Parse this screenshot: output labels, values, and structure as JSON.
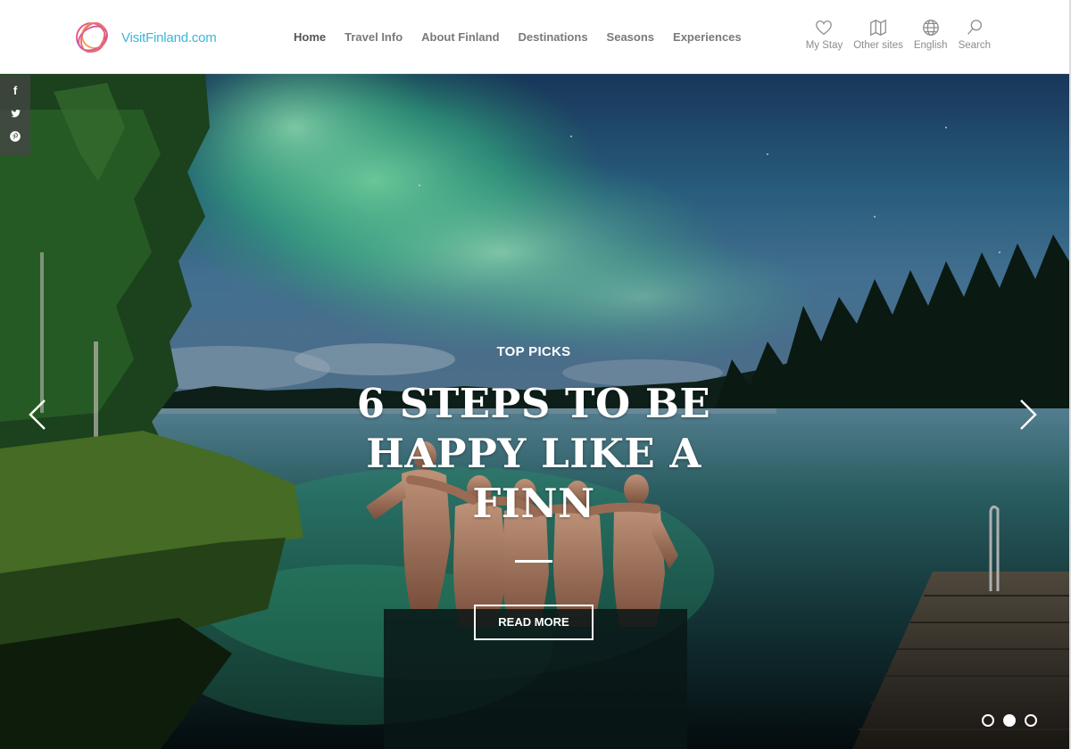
{
  "site": {
    "logo_text": "VisitFinland.com"
  },
  "nav": {
    "items": [
      {
        "label": "Home",
        "active": true
      },
      {
        "label": "Travel Info"
      },
      {
        "label": "About Finland"
      },
      {
        "label": "Destinations"
      },
      {
        "label": "Seasons"
      },
      {
        "label": "Experiences"
      }
    ]
  },
  "utilities": {
    "my_stay": {
      "label": "My Stay",
      "icon": "heart-icon"
    },
    "other_sites": {
      "label": "Other sites",
      "icon": "map-icon"
    },
    "language": {
      "label": "English",
      "icon": "globe-icon"
    },
    "search": {
      "label": "Search",
      "icon": "search-icon"
    }
  },
  "social": {
    "facebook": "f",
    "twitter": "twitter-icon",
    "pinterest": "pinterest-icon"
  },
  "hero": {
    "eyebrow": "TOP PICKS",
    "headline": "6 STEPS TO BE HAPPY LIKE A FINN",
    "cta_label": "READ MORE",
    "slide_count": 3,
    "active_slide": 2
  },
  "colors": {
    "brand_blue": "#3ab7d8",
    "logo_pink": "#e8507a",
    "logo_orange": "#f29b5b"
  }
}
